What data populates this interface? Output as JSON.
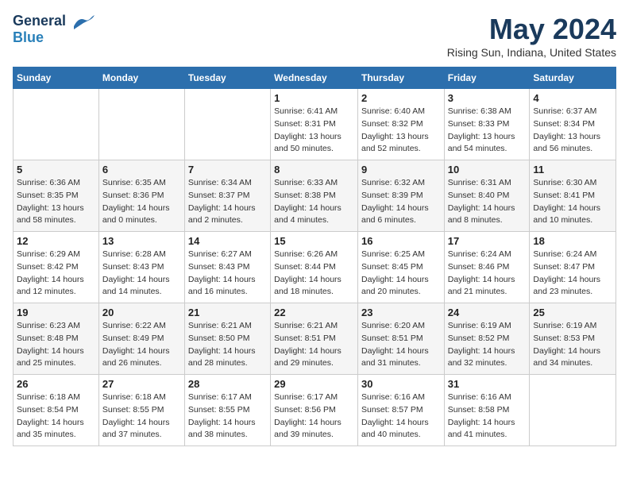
{
  "logo": {
    "general": "General",
    "blue": "Blue"
  },
  "title": "May 2024",
  "location": "Rising Sun, Indiana, United States",
  "weekdays": [
    "Sunday",
    "Monday",
    "Tuesday",
    "Wednesday",
    "Thursday",
    "Friday",
    "Saturday"
  ],
  "weeks": [
    [
      {
        "day": "",
        "sunrise": "",
        "sunset": "",
        "daylight": ""
      },
      {
        "day": "",
        "sunrise": "",
        "sunset": "",
        "daylight": ""
      },
      {
        "day": "",
        "sunrise": "",
        "sunset": "",
        "daylight": ""
      },
      {
        "day": "1",
        "sunrise": "Sunrise: 6:41 AM",
        "sunset": "Sunset: 8:31 PM",
        "daylight": "Daylight: 13 hours and 50 minutes."
      },
      {
        "day": "2",
        "sunrise": "Sunrise: 6:40 AM",
        "sunset": "Sunset: 8:32 PM",
        "daylight": "Daylight: 13 hours and 52 minutes."
      },
      {
        "day": "3",
        "sunrise": "Sunrise: 6:38 AM",
        "sunset": "Sunset: 8:33 PM",
        "daylight": "Daylight: 13 hours and 54 minutes."
      },
      {
        "day": "4",
        "sunrise": "Sunrise: 6:37 AM",
        "sunset": "Sunset: 8:34 PM",
        "daylight": "Daylight: 13 hours and 56 minutes."
      }
    ],
    [
      {
        "day": "5",
        "sunrise": "Sunrise: 6:36 AM",
        "sunset": "Sunset: 8:35 PM",
        "daylight": "Daylight: 13 hours and 58 minutes."
      },
      {
        "day": "6",
        "sunrise": "Sunrise: 6:35 AM",
        "sunset": "Sunset: 8:36 PM",
        "daylight": "Daylight: 14 hours and 0 minutes."
      },
      {
        "day": "7",
        "sunrise": "Sunrise: 6:34 AM",
        "sunset": "Sunset: 8:37 PM",
        "daylight": "Daylight: 14 hours and 2 minutes."
      },
      {
        "day": "8",
        "sunrise": "Sunrise: 6:33 AM",
        "sunset": "Sunset: 8:38 PM",
        "daylight": "Daylight: 14 hours and 4 minutes."
      },
      {
        "day": "9",
        "sunrise": "Sunrise: 6:32 AM",
        "sunset": "Sunset: 8:39 PM",
        "daylight": "Daylight: 14 hours and 6 minutes."
      },
      {
        "day": "10",
        "sunrise": "Sunrise: 6:31 AM",
        "sunset": "Sunset: 8:40 PM",
        "daylight": "Daylight: 14 hours and 8 minutes."
      },
      {
        "day": "11",
        "sunrise": "Sunrise: 6:30 AM",
        "sunset": "Sunset: 8:41 PM",
        "daylight": "Daylight: 14 hours and 10 minutes."
      }
    ],
    [
      {
        "day": "12",
        "sunrise": "Sunrise: 6:29 AM",
        "sunset": "Sunset: 8:42 PM",
        "daylight": "Daylight: 14 hours and 12 minutes."
      },
      {
        "day": "13",
        "sunrise": "Sunrise: 6:28 AM",
        "sunset": "Sunset: 8:43 PM",
        "daylight": "Daylight: 14 hours and 14 minutes."
      },
      {
        "day": "14",
        "sunrise": "Sunrise: 6:27 AM",
        "sunset": "Sunset: 8:43 PM",
        "daylight": "Daylight: 14 hours and 16 minutes."
      },
      {
        "day": "15",
        "sunrise": "Sunrise: 6:26 AM",
        "sunset": "Sunset: 8:44 PM",
        "daylight": "Daylight: 14 hours and 18 minutes."
      },
      {
        "day": "16",
        "sunrise": "Sunrise: 6:25 AM",
        "sunset": "Sunset: 8:45 PM",
        "daylight": "Daylight: 14 hours and 20 minutes."
      },
      {
        "day": "17",
        "sunrise": "Sunrise: 6:24 AM",
        "sunset": "Sunset: 8:46 PM",
        "daylight": "Daylight: 14 hours and 21 minutes."
      },
      {
        "day": "18",
        "sunrise": "Sunrise: 6:24 AM",
        "sunset": "Sunset: 8:47 PM",
        "daylight": "Daylight: 14 hours and 23 minutes."
      }
    ],
    [
      {
        "day": "19",
        "sunrise": "Sunrise: 6:23 AM",
        "sunset": "Sunset: 8:48 PM",
        "daylight": "Daylight: 14 hours and 25 minutes."
      },
      {
        "day": "20",
        "sunrise": "Sunrise: 6:22 AM",
        "sunset": "Sunset: 8:49 PM",
        "daylight": "Daylight: 14 hours and 26 minutes."
      },
      {
        "day": "21",
        "sunrise": "Sunrise: 6:21 AM",
        "sunset": "Sunset: 8:50 PM",
        "daylight": "Daylight: 14 hours and 28 minutes."
      },
      {
        "day": "22",
        "sunrise": "Sunrise: 6:21 AM",
        "sunset": "Sunset: 8:51 PM",
        "daylight": "Daylight: 14 hours and 29 minutes."
      },
      {
        "day": "23",
        "sunrise": "Sunrise: 6:20 AM",
        "sunset": "Sunset: 8:51 PM",
        "daylight": "Daylight: 14 hours and 31 minutes."
      },
      {
        "day": "24",
        "sunrise": "Sunrise: 6:19 AM",
        "sunset": "Sunset: 8:52 PM",
        "daylight": "Daylight: 14 hours and 32 minutes."
      },
      {
        "day": "25",
        "sunrise": "Sunrise: 6:19 AM",
        "sunset": "Sunset: 8:53 PM",
        "daylight": "Daylight: 14 hours and 34 minutes."
      }
    ],
    [
      {
        "day": "26",
        "sunrise": "Sunrise: 6:18 AM",
        "sunset": "Sunset: 8:54 PM",
        "daylight": "Daylight: 14 hours and 35 minutes."
      },
      {
        "day": "27",
        "sunrise": "Sunrise: 6:18 AM",
        "sunset": "Sunset: 8:55 PM",
        "daylight": "Daylight: 14 hours and 37 minutes."
      },
      {
        "day": "28",
        "sunrise": "Sunrise: 6:17 AM",
        "sunset": "Sunset: 8:55 PM",
        "daylight": "Daylight: 14 hours and 38 minutes."
      },
      {
        "day": "29",
        "sunrise": "Sunrise: 6:17 AM",
        "sunset": "Sunset: 8:56 PM",
        "daylight": "Daylight: 14 hours and 39 minutes."
      },
      {
        "day": "30",
        "sunrise": "Sunrise: 6:16 AM",
        "sunset": "Sunset: 8:57 PM",
        "daylight": "Daylight: 14 hours and 40 minutes."
      },
      {
        "day": "31",
        "sunrise": "Sunrise: 6:16 AM",
        "sunset": "Sunset: 8:58 PM",
        "daylight": "Daylight: 14 hours and 41 minutes."
      },
      {
        "day": "",
        "sunrise": "",
        "sunset": "",
        "daylight": ""
      }
    ]
  ]
}
